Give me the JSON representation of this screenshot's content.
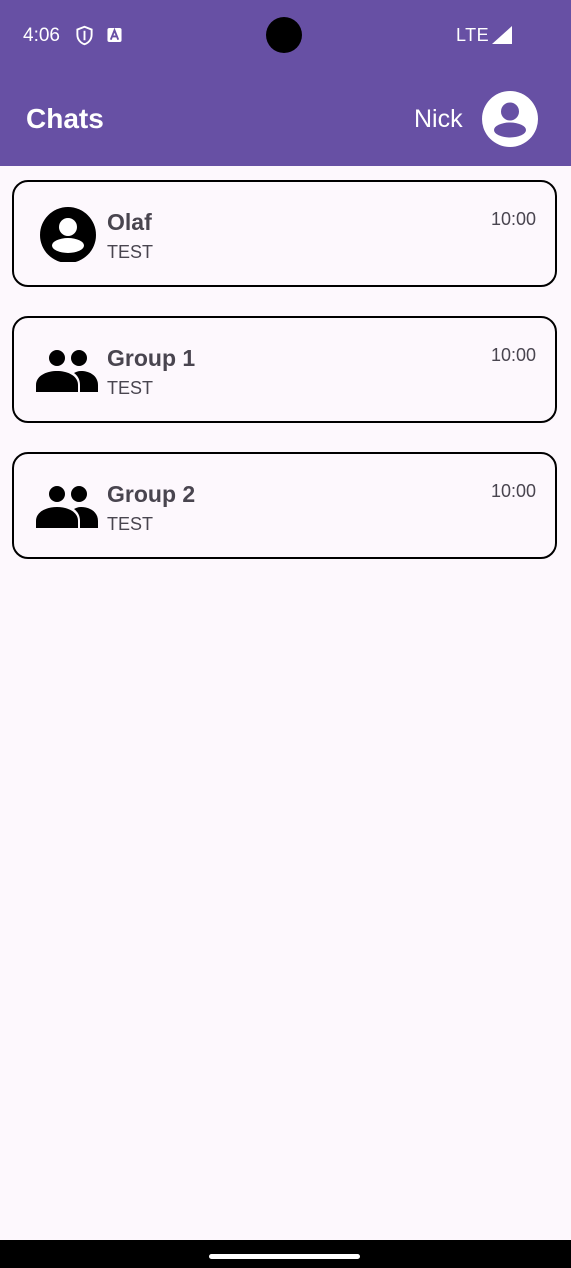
{
  "status_bar": {
    "time": "4:06",
    "network": "LTE",
    "icons": [
      "shield-icon",
      "a-icon",
      "signal-icon"
    ]
  },
  "app_bar": {
    "title": "Chats",
    "user_name": "Nick",
    "avatar_icon": "account-circle-icon"
  },
  "chats": [
    {
      "name": "Olaf",
      "preview": "TEST",
      "time": "10:00",
      "icon": "account-circle-icon"
    },
    {
      "name": "Group 1",
      "preview": "TEST",
      "time": "10:00",
      "icon": "group-icon"
    },
    {
      "name": "Group 2",
      "preview": "TEST",
      "time": "10:00",
      "icon": "group-icon"
    }
  ],
  "colors": {
    "primary": "#6750a4",
    "background": "#fdf8fd",
    "text_secondary": "#49454f"
  }
}
